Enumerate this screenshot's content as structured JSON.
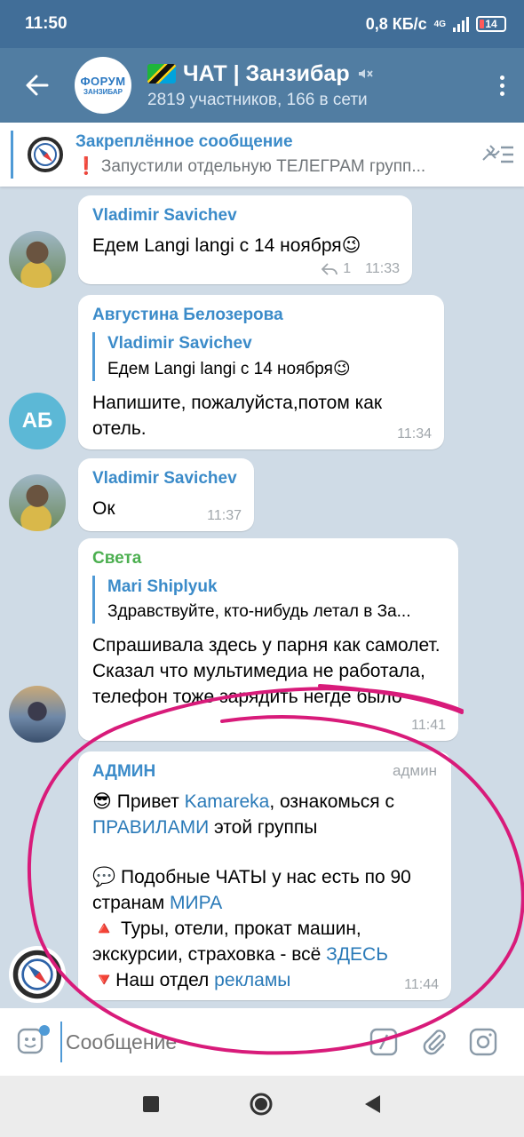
{
  "status": {
    "time": "11:50",
    "speed": "0,8 КБ/с",
    "network": "4G",
    "battery": "14"
  },
  "header": {
    "title": "ЧАТ | Занзибар",
    "subtitle": "2819 участников, 166 в сети",
    "avatar_line1": "ФОРУМ",
    "avatar_line2": "ЗАНЗИБАР"
  },
  "pinned": {
    "title": "Закреплённое сообщение",
    "text": "❗ Запустили отдельную ТЕЛЕГРАМ групп..."
  },
  "messages": [
    {
      "sender": "Vladimir Savichev",
      "text": "Едем Langi langi с 14 ноября😉",
      "replies": "1",
      "time": "11:33"
    },
    {
      "sender": "Августина Белозерова",
      "avatar_initials": "АБ",
      "quote_name": "Vladimir Savichev",
      "quote_text": "Едем Langi langi с 14 ноября😉",
      "text": "Напишите, пожалуйста,потом как отель.",
      "time": "11:34"
    },
    {
      "sender": "Vladimir Savichev",
      "text": "Ок",
      "time": "11:37"
    },
    {
      "sender": "Света",
      "quote_name": "Mari Shiplyuk",
      "quote_text": "Здравствуйте, кто-нибудь летал в За...",
      "text": "Спрашивала здесь у парня как самолет. Сказал что мультимедиа не работала, телефон тоже зарядить негде было",
      "time": "11:41"
    },
    {
      "sender": "АДМИН",
      "role": "админ",
      "time": "11:44",
      "line1_pre": "😎 Привет ",
      "line1_link": "Kamareka",
      "line1_mid": ", ознакомься с ",
      "line1_link2": "ПРАВИЛАМИ",
      "line1_post": " этой группы",
      "line2_pre": "💬 Подобные ЧАТЫ у нас есть по 90 странам ",
      "line2_link": "МИРА",
      "line3_pre": "🔺 Туры, отели, прокат машин, экскурсии, страховка - всё ",
      "line3_link": "ЗДЕСЬ",
      "line4_pre": "🔻Наш отдел ",
      "line4_link": "рекламы"
    }
  ],
  "input": {
    "placeholder": "Сообщение"
  },
  "colors": {
    "header": "#517da2",
    "statusbar": "#416e98",
    "accent": "#4f9ad6",
    "annotation": "#d81b7a"
  }
}
